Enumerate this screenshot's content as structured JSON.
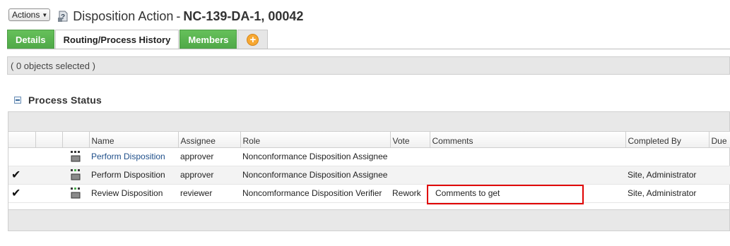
{
  "header": {
    "actions_label": "Actions",
    "title_prefix": "Disposition Action",
    "title_separator": "-",
    "title_number": "NC-139-DA-1, 00042"
  },
  "tabs": [
    {
      "label": "Details",
      "style": "green"
    },
    {
      "label": "Routing/Process History",
      "style": "active"
    },
    {
      "label": "Members",
      "style": "green"
    },
    {
      "label": "add-tab-icon",
      "style": "add"
    }
  ],
  "selection_status": "( 0 objects selected )",
  "section": {
    "title": "Process Status",
    "columns": [
      "Name",
      "Assignee",
      "Role",
      "Vote",
      "Comments",
      "Completed By",
      "Due"
    ],
    "rows": [
      {
        "checked": false,
        "name": "Perform Disposition",
        "name_link": true,
        "assignee": "approver",
        "role": "Nonconformance Disposition Assignee",
        "vote": "",
        "comments": "",
        "completed_by": "",
        "due": ""
      },
      {
        "checked": true,
        "name": "Perform Disposition",
        "name_link": false,
        "assignee": "approver",
        "role": "Nonconformance Disposition Assignee",
        "vote": "",
        "comments": "",
        "completed_by": "Site, Administrator",
        "due": ""
      },
      {
        "checked": true,
        "name": "Review Disposition",
        "name_link": false,
        "assignee": "reviewer",
        "role": "Noncomformance Disposition Verifier",
        "vote": "Rework",
        "comments": "Comments to get",
        "completed_by": "Site, Administrator",
        "due": ""
      }
    ]
  },
  "colors": {
    "tab_green": "#5cb85c",
    "link": "#1f4f8a",
    "highlight": "#e00000",
    "add_orange": "#f7a832"
  }
}
